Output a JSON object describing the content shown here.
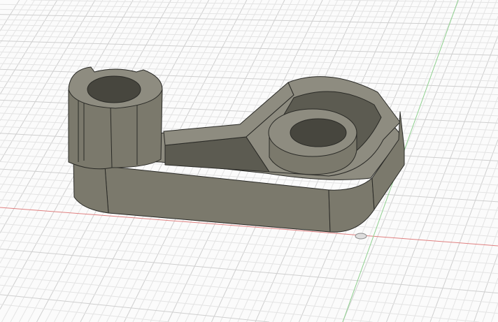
{
  "viewport": {
    "colors": {
      "background": "#fbfbfb",
      "grid_minor": "#e4e4e4",
      "grid_major": "#cfcfcf",
      "x_axis": "#e08080",
      "y_axis": "#8fd08f",
      "body": "#7b796c",
      "body_dark": "#5c5b51",
      "body_top": "#8e8c80",
      "hole": "#47463e",
      "edge": "#2a2a26"
    }
  }
}
